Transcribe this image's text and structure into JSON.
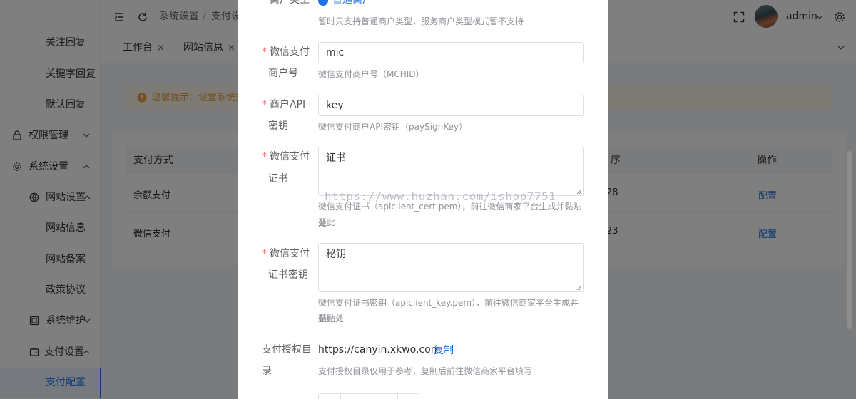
{
  "sidebar": {
    "items": [
      {
        "label": "关注回复"
      },
      {
        "label": "关键字回复"
      },
      {
        "label": "默认回复"
      },
      {
        "label": "权限管理"
      },
      {
        "label": "系统设置"
      },
      {
        "label": "网站设置"
      },
      {
        "label": "网站信息"
      },
      {
        "label": "网站备案"
      },
      {
        "label": "政策协议"
      },
      {
        "label": "系统维护"
      },
      {
        "label": "支付设置"
      },
      {
        "label": "支付配置"
      }
    ]
  },
  "header": {
    "breadcrumb": [
      "系统设置",
      "支付设"
    ],
    "breadcrumb_sep": "/",
    "user": "admin"
  },
  "tabs": [
    {
      "label": "工作台",
      "close": "×"
    },
    {
      "label": "网站信息",
      "close": "×"
    }
  ],
  "alert": {
    "text": "温馨提示：设置系统支"
  },
  "table": {
    "headers": [
      "支付方式",
      "序",
      "操作"
    ],
    "rows": [
      {
        "name": "余额支付",
        "order": "28",
        "action": "配置"
      },
      {
        "name": "微信支付",
        "order": "23",
        "action": "配置"
      }
    ]
  },
  "modal": {
    "merchant_type_label": "商户类型",
    "merchant_type_value": "普通商户",
    "merchant_type_help": "暂时只支持普通商户类型，服务商户类型模式暂不支持",
    "mchid": {
      "label_1": "微信支付",
      "label_2": "商户号",
      "value": "mic",
      "help": "微信支付商户号（MCHID）"
    },
    "apikey": {
      "label_1": "商户API",
      "label_2": "密钥",
      "value": "key",
      "help": "微信支付商户API密钥（paySignKey）"
    },
    "cert": {
      "label_1": "微信支付",
      "label_2": "证书",
      "value": "证书",
      "help_1": "微信支付证书（apiclient_cert.pem），前往微信商家平台生成并黏贴至此",
      "help_2": "处"
    },
    "cert_key": {
      "label_1": "微信支付",
      "label_2": "证书密钥",
      "value": "秘钥",
      "help_1": "微信支付证书密钥（apiclient_key.pem），前往微信商家平台生成并黏贴",
      "help_2": "至此处"
    },
    "auth_dir": {
      "label_1": "支付授权目",
      "label_2": "录",
      "value": "https://canyin.xkwo.com",
      "copy": "复制",
      "help": "支付授权目录仅用于参考，复制后前往微信商家平台填写"
    },
    "required_mark": "*",
    "watermark": "https://www.huzhan.com/ishop7751"
  },
  "colors": {
    "primary": "#1e73e8",
    "link": "#1e6fdc",
    "warning": "#e6a23c",
    "danger": "#f56c6c"
  }
}
